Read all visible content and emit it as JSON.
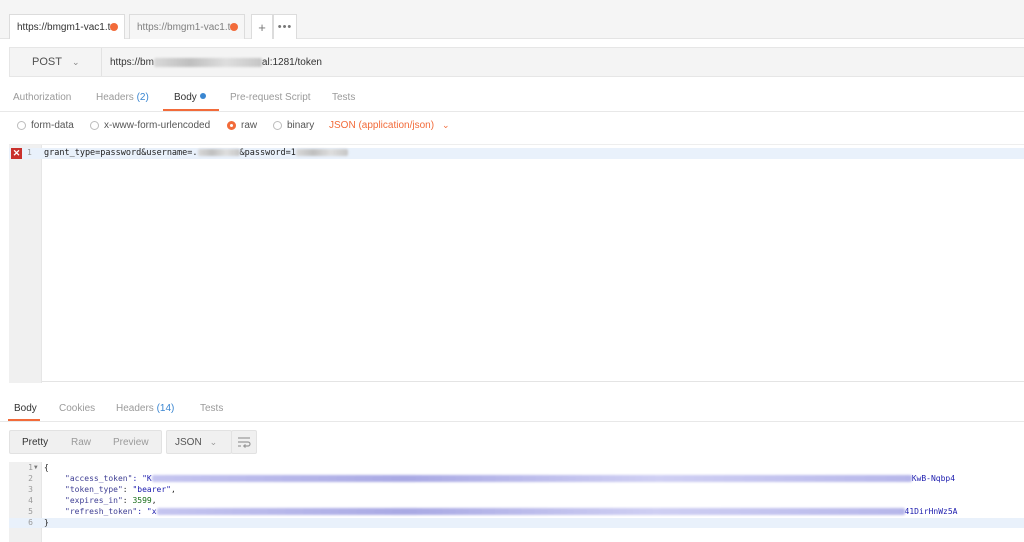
{
  "tabs": [
    {
      "label": "https://bmgm1-vac1.t",
      "unsaved": true
    },
    {
      "label": "https://bmgm1-vac1.t",
      "unsaved": true
    }
  ],
  "tab_actions": {
    "add": "+",
    "more": "•••"
  },
  "request": {
    "method": "POST",
    "url_prefix": "https://bm",
    "url_suffix": "al:1281/token"
  },
  "request_tabs": {
    "authorization": "Authorization",
    "headers": "Headers",
    "headers_count": "(2)",
    "body": "Body",
    "prerequest": "Pre-request Script",
    "tests": "Tests"
  },
  "body_types": {
    "form_data": "form-data",
    "urlencoded": "x-www-form-urlencoded",
    "raw": "raw",
    "binary": "binary",
    "selected": "raw",
    "content_type": "JSON (application/json)"
  },
  "request_body": {
    "line_number": "1",
    "error_marker": "✕",
    "part1": "grant_type=password&username=.",
    "part2": "&password=1"
  },
  "response_tabs": {
    "body": "Body",
    "cookies": "Cookies",
    "headers": "Headers",
    "headers_count": "(14)",
    "tests": "Tests"
  },
  "response_toolbar": {
    "pretty": "Pretty",
    "raw": "Raw",
    "preview": "Preview",
    "format": "JSON"
  },
  "response_body": {
    "line1": {
      "num": "1",
      "text": "{"
    },
    "line2": {
      "num": "2",
      "key": "\"access_token\"",
      "value_start": ": \"K",
      "value_end": "KwB-Nqbp4"
    },
    "line3": {
      "num": "3",
      "key": "\"token_type\"",
      "value": "\"bearer\""
    },
    "line4": {
      "num": "4",
      "key": "\"expires_in\"",
      "value": "3599"
    },
    "line5": {
      "num": "5",
      "key": "\"refresh_token\"",
      "value_start": ": \"x",
      "value_end": "41DirHnWz5A"
    },
    "line6": {
      "num": "6",
      "text": "}"
    }
  },
  "colors": {
    "accent": "#f26b3a",
    "link": "#3a86d1",
    "error": "#c9302c"
  },
  "icons": {
    "wrap": "wrap-lines-icon",
    "chevron": "chevron-down-icon",
    "dirty_dot": "unsaved-dot-icon"
  }
}
